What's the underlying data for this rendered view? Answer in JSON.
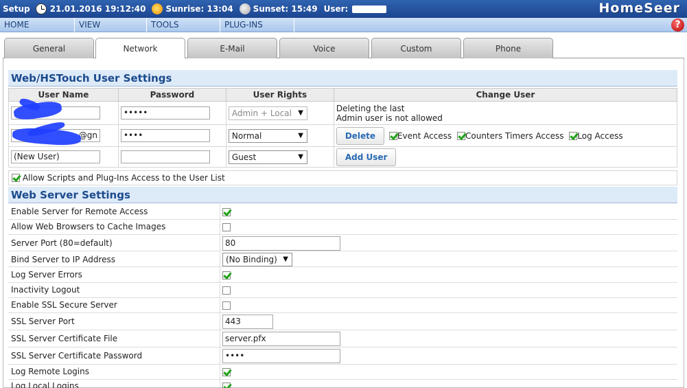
{
  "topbar": {
    "setup": "Setup",
    "datetime": "21.01.2016 19:12:40",
    "sunrise": "Sunrise: 13:04",
    "sunset": "Sunset: 15:49",
    "user_label": "User:",
    "logo": "HomeSeer"
  },
  "menu": {
    "items": [
      "HOME",
      "VIEW",
      "TOOLS",
      "PLUG-INS"
    ],
    "help": "?"
  },
  "tabs": [
    "General",
    "Network",
    "E-Mail",
    "Voice",
    "Custom",
    "Phone"
  ],
  "active_tab": "Network",
  "user_section": {
    "title": "Web/HSTouch User Settings",
    "columns": [
      "User Name",
      "Password",
      "User Rights",
      "Change User"
    ],
    "rows": [
      {
        "username": "",
        "password": "•••••",
        "rights": "Admin + Local",
        "note_line1": "Deleting the last",
        "note_line2": "Admin user is not allowed"
      },
      {
        "username": "@gn",
        "password": "••••",
        "rights": "Normal",
        "button": "Delete",
        "perms": [
          "Event Access",
          "Counters Timers Access",
          "Log Access"
        ]
      },
      {
        "username": "(New User)",
        "password": "",
        "rights": "Guest",
        "button": "Add User"
      }
    ],
    "allow_scripts": "Allow Scripts and Plug-Ins Access to the User List"
  },
  "server_section": {
    "title": "Web Server Settings",
    "rows": [
      {
        "label": "Enable Server for Remote Access",
        "checked": true
      },
      {
        "label": "Allow Web Browsers to Cache Images",
        "checked": false
      },
      {
        "label": "Server Port (80=default)",
        "value": "80"
      },
      {
        "label": "Bind Server to IP Address",
        "value": "(No Binding)"
      },
      {
        "label": "Log Server Errors",
        "checked": true
      },
      {
        "label": "Inactivity Logout",
        "checked": false
      },
      {
        "label": "Enable SSL Secure Server",
        "checked": false
      },
      {
        "label": "SSL Server Port",
        "value": "443"
      },
      {
        "label": "SSL Server Certificate File",
        "value": "server.pfx"
      },
      {
        "label": "SSL Server Certificate Password",
        "value": "••••"
      },
      {
        "label": "Log Remote Logins",
        "checked": true
      },
      {
        "label": "Log Local Logins",
        "checked": true
      }
    ]
  }
}
